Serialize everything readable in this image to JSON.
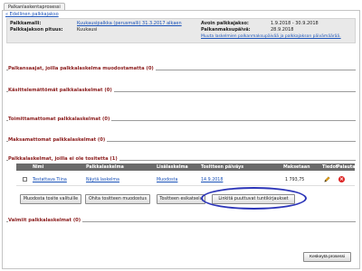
{
  "tab": {
    "label": "Palkanlaskentaprosessi"
  },
  "prev_link": "« Edellinen palkkajakso",
  "info": {
    "palkkamalli_label": "Palkkamalli:",
    "palkkamalli_value": "Kuukausipalkka (perusmalli) 31.3.2017 alkaen",
    "pituus_label": "Palkkajakson pituus:",
    "pituus_value": "Kuukausi",
    "avoin_label": "Avoin palkkajakso:",
    "avoin_value": "1.9.2018 - 30.9.2018",
    "maksupaiva_label": "Palkanmaksupäivä:",
    "maksupaiva_value": "28.9.2018",
    "muuta_link": "Muuta laskelmien palkanmaksupäivää ja palkkajakson päivämäärää."
  },
  "sections": [
    "Palkansaajat, joilla palkkalaskelma muodostamatta (0)",
    "Käsittelemättömät palkkalaskelmat (0)",
    "Toimittamattomat palkkalaskelmat (0)",
    "Maksamattomat palkkalaskelmat (0)",
    "Palkkalaskelmat, joilla ei ole tositetta (1)",
    "Valmiit palkkalaskelmat (0)"
  ],
  "table": {
    "headers": [
      "Nimi",
      "Palkkalaskelma",
      "Lisälaskelma",
      "Tositteen päiväys",
      "Maksetaan",
      "Tiedot",
      "Palauta"
    ],
    "row": {
      "nimi": "Testattava Tiina",
      "palkkalaskelma": "Näytä laskelma",
      "lisalaskelma": "Muodosta",
      "paivays": "14.9.2018",
      "maksetaan": "1 793,75"
    }
  },
  "buttons": {
    "muodosta": "Muodosta tosite valituille",
    "ohita": "Ohita tositteen muodostus",
    "esikatselu": "Tositteen esikatselu",
    "linkita": "Linkitä puuttuvat tuntikirjaukset"
  },
  "footer": {
    "keskeyta": "Keskeytä prosessi"
  },
  "colors": {
    "section_title": "#8b1c1c",
    "link": "#1a52b8",
    "highlight": "#2c35b8",
    "delete": "#dd2222"
  }
}
